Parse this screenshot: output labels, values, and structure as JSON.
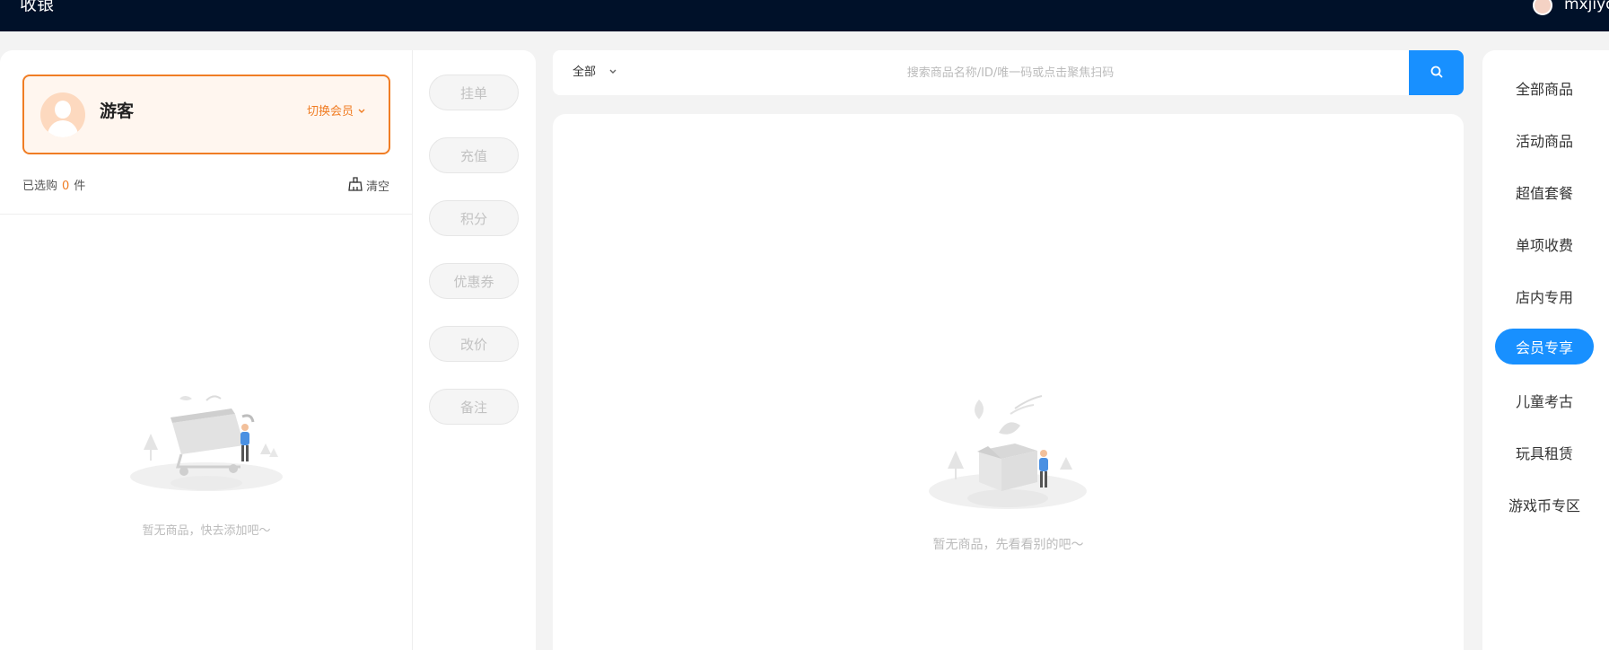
{
  "header": {
    "title": "收银",
    "username": "mxjiyd"
  },
  "member": {
    "name": "游客",
    "switch_label": "切换会员"
  },
  "cart": {
    "selected_prefix": "已选购",
    "selected_count": "0",
    "selected_suffix": "件",
    "clear_label": "清空",
    "empty_text": "暂无商品，快去添加吧～"
  },
  "actions": [
    "挂单",
    "充值",
    "积分",
    "优惠券",
    "改价",
    "备注"
  ],
  "search": {
    "category": "全部",
    "placeholder": "搜索商品名称/ID/唯一码或点击聚焦扫码"
  },
  "products": {
    "empty_text": "暂无商品，先看看别的吧～"
  },
  "categories": {
    "items": [
      "全部商品",
      "活动商品",
      "超值套餐",
      "单项收费",
      "店内专用",
      "会员专享",
      "儿童考古",
      "玩具租赁",
      "游戏币专区"
    ],
    "active": "会员专享"
  },
  "colors": {
    "accent": "#1890ff",
    "orange": "#f07d24",
    "header_bg": "#001129"
  }
}
